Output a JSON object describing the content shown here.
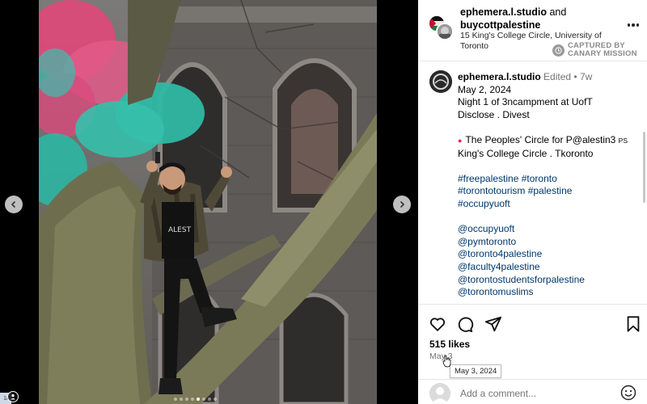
{
  "header": {
    "user1": "ephemera.l.studio",
    "joiner": "and",
    "user2": "buycottpalestine",
    "location": "15 King's College Circle, University of Toronto",
    "watermark_line1": "CAPTURED BY",
    "watermark_line2": "CANARY MISSION"
  },
  "caption": {
    "username": "ephemera.l.studio",
    "edited": "Edited",
    "separator": "•",
    "age": "7w",
    "date": "May 2, 2024",
    "line1": "Night 1 of 3ncampment at UofT",
    "line2": "Disclose . Divest",
    "line3_main": "The Peoples' Circle for P@alestin3",
    "line3_small": "PS",
    "line4": "King's College Circle . Tkoronto",
    "hashtags": [
      "#freepalestine #toronto",
      "#torontotourism #palestine",
      "#occupyuoft"
    ],
    "mentions": [
      "@occupyuoft",
      "@pymtoronto",
      "@toronto4palestine",
      "@faculty4palestine",
      "@torontostudentsforpalestine",
      "@torontomuslims"
    ]
  },
  "actions": {
    "likes": "515 likes",
    "date_short": "May 3",
    "tooltip": "May 3, 2024"
  },
  "comment": {
    "placeholder": "Add a comment..."
  },
  "icons": {
    "like": "heart-icon",
    "comment": "comment-icon",
    "share": "share-icon",
    "save": "bookmark-icon",
    "more": "more-icon",
    "emoji": "emoji-icon",
    "prev": "chevron-left-icon",
    "next": "chevron-right-icon"
  },
  "carousel": {
    "count": 8,
    "active": 4
  },
  "corner_badge": "1/",
  "colors": {
    "link": "#00376b",
    "muted": "#737373",
    "pin": "#e0245e"
  }
}
